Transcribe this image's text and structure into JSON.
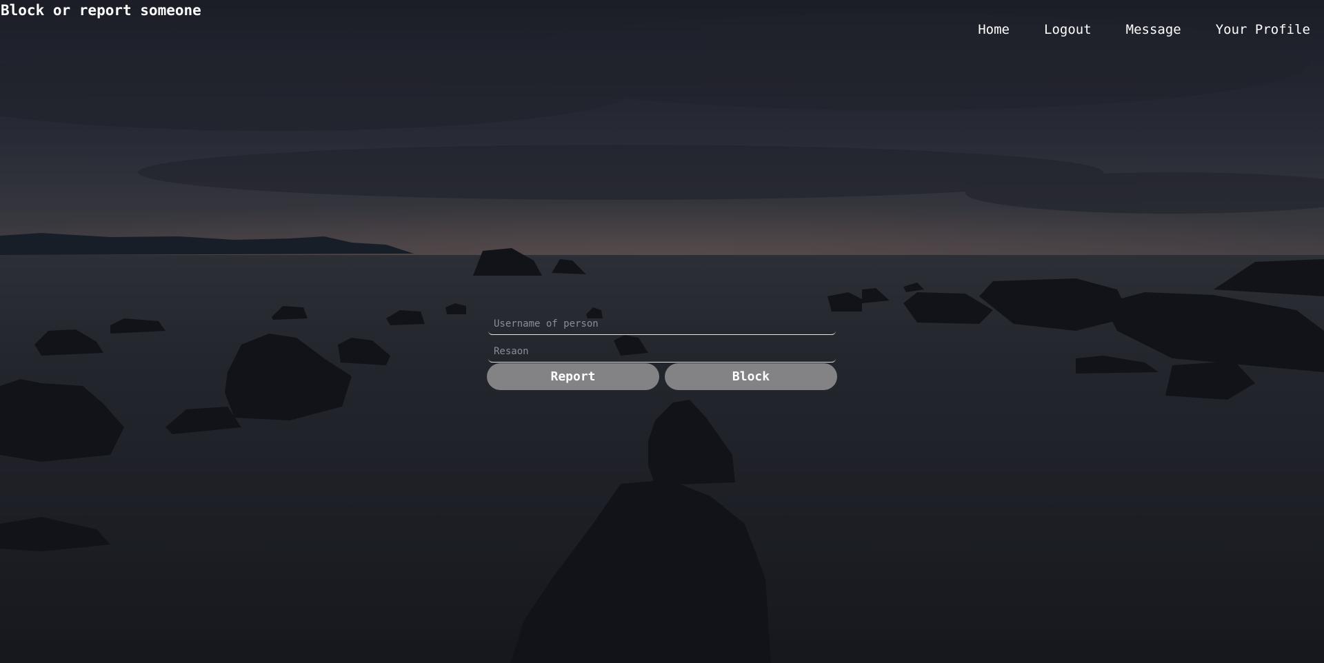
{
  "page": {
    "title": "Block or report someone",
    "background": "night-seascape-with-rocks-and-mist-image"
  },
  "nav": {
    "items": [
      {
        "label": "Home"
      },
      {
        "label": "Logout"
      },
      {
        "label": "Message"
      },
      {
        "label": "Your Profile"
      }
    ]
  },
  "form": {
    "username": {
      "placeholder": "Username of person",
      "value": ""
    },
    "reason": {
      "placeholder": "Resaon",
      "value": ""
    },
    "report_label": "Report",
    "block_label": "Block"
  },
  "colors": {
    "text": "#ffffff",
    "button_bg": "#838385",
    "placeholder": "#8c8d94",
    "field_border": "#e6e6ea",
    "sky": "#2a2d3a",
    "sea": "#20222b",
    "horizon_glow": "#7a6a70"
  }
}
